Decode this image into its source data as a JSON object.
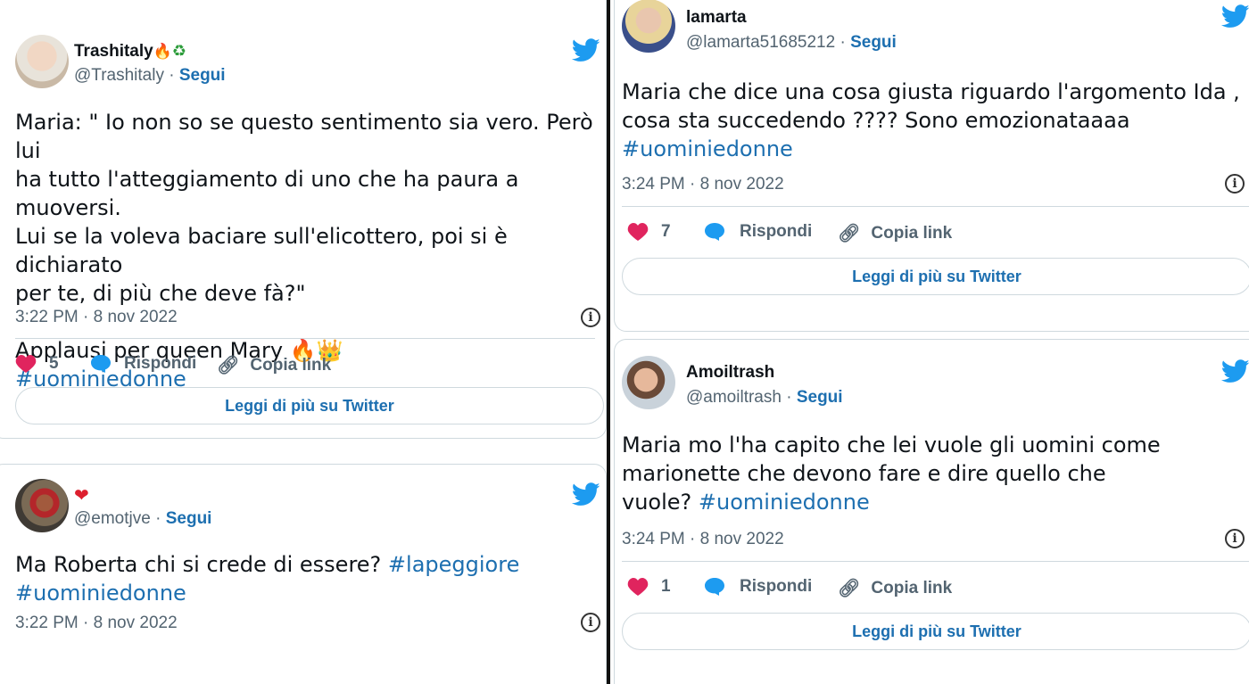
{
  "colors": {
    "link": "#1d6fb0",
    "heart": "#e0245e",
    "bubble": "#1d9bf0",
    "bird": "#1d9bf0",
    "muted": "#536471"
  },
  "tweets": [
    {
      "name": "Trashitaly",
      "name_emoji": "🔥",
      "handle": "@Trashitaly",
      "sep": " · ",
      "follow": "Segui",
      "lines": [
        "Maria: \" Io non so se questo sentimento sia vero. Però lui",
        "ha tutto l'atteggiamento di uno che ha paura a muoversi.",
        "Lui se la voleva baciare sull'elicottero, poi si è dichiarato",
        "per te, di più che deve fà?\"",
        "",
        "Applausi per queen Mary 🔥👑"
      ],
      "hashtags": [
        "#uominiedonne"
      ],
      "time": "3:22 PM · 8 nov 2022",
      "likes": "5",
      "reply": "Rispondi",
      "copy": "Copia link",
      "readmore": "Leggi di più su Twitter"
    },
    {
      "name": "",
      "name_emoji": "❤",
      "handle": "@emotjve",
      "sep": " · ",
      "follow": "Segui",
      "text_plain": "Ma Roberta chi si crede di essere? ",
      "hashtag_inline": "#lapeggiore",
      "hashtags": [
        "#uominiedonne"
      ],
      "time": "3:22 PM · 8 nov 2022"
    },
    {
      "name": "lamarta",
      "handle": "@lamarta51685212",
      "sep": " · ",
      "follow": "Segui",
      "lines": [
        "Maria che dice una cosa giusta riguardo l'argomento Ida ,",
        "cosa sta succedendo ???? Sono emozionataaaa"
      ],
      "hashtags": [
        "#uominiedonne"
      ],
      "time": "3:24 PM · 8 nov 2022",
      "likes": "7",
      "reply": "Rispondi",
      "copy": "Copia link",
      "readmore": "Leggi di più su Twitter"
    },
    {
      "name": "Amoiltrash",
      "handle": "@amoiltrash",
      "sep": " · ",
      "follow": "Segui",
      "lines": [
        "Maria mo l'ha capito che lei vuole gli uomini come",
        "marionette che devono fare e dire quello che"
      ],
      "last_line_plain": "vuole?  ",
      "hashtags": [
        "#uominiedonne"
      ],
      "time": "3:24 PM · 8 nov 2022",
      "likes": "1",
      "reply": "Rispondi",
      "copy": "Copia link",
      "readmore": "Leggi di più su Twitter"
    }
  ]
}
